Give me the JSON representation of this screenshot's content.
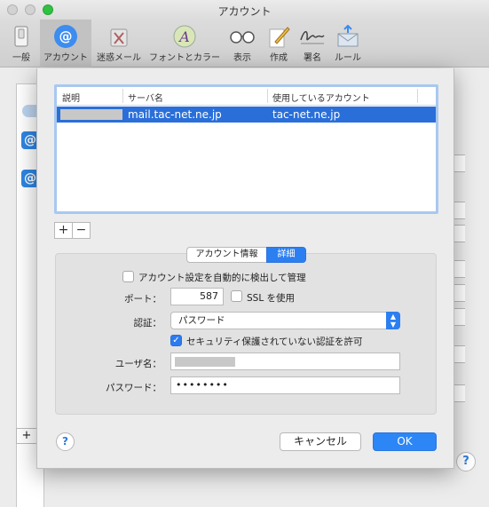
{
  "window": {
    "title": "アカウント"
  },
  "toolbar": {
    "items": [
      {
        "label": "一般",
        "icon": "switch-icon"
      },
      {
        "label": "アカウント",
        "icon": "at-icon"
      },
      {
        "label": "迷惑メール",
        "icon": "trash-icon"
      },
      {
        "label": "フォントとカラー",
        "icon": "font-icon"
      },
      {
        "label": "表示",
        "icon": "glasses-icon"
      },
      {
        "label": "作成",
        "icon": "pencil-icon"
      },
      {
        "label": "署名",
        "icon": "signature-icon"
      },
      {
        "label": "ルール",
        "icon": "envelope-icon"
      }
    ]
  },
  "table": {
    "columns": [
      "説明",
      "サーバ名",
      "使用しているアカウント"
    ],
    "rows": [
      {
        "description": "",
        "server": "mail.tac-net.ne.jp",
        "account": "tac-net.ne.jp",
        "selected": true
      }
    ]
  },
  "list_controls": {
    "add": "+",
    "remove": "−"
  },
  "tabs": {
    "info": "アカウント情報",
    "advanced": "詳細",
    "active": "advanced"
  },
  "form": {
    "auto_detect_label": "アカウント設定を自動的に検出して管理",
    "auto_detect_checked": false,
    "port_label": "ポート：",
    "port_value": "587",
    "ssl_label": "SSL を使用",
    "ssl_checked": false,
    "auth_label": "認証：",
    "auth_value": "パスワード",
    "insecure_auth_label": "セキュリティ保護されていない認証を許可",
    "insecure_auth_checked": true,
    "username_label": "ユーザ名：",
    "username_value": "",
    "password_label": "パスワード：",
    "password_value": "••••••••"
  },
  "buttons": {
    "help": "?",
    "cancel": "キャンセル",
    "ok": "OK"
  },
  "background": {
    "add": "+",
    "help": "?",
    "account_glyph": "@"
  },
  "colors": {
    "accent": "#2c7ff0",
    "selection": "#2a6fd9"
  }
}
